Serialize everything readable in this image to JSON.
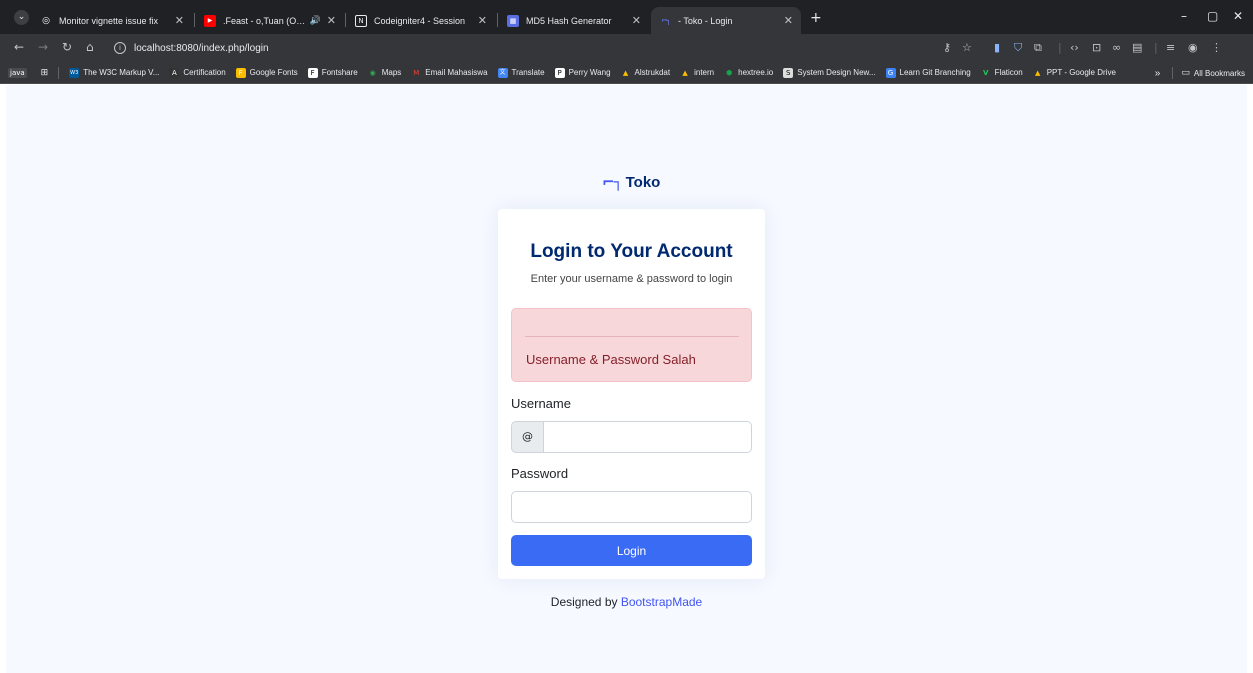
{
  "browser": {
    "tabs": [
      {
        "title": "Monitor vignette issue fix",
        "favicon": "chatgpt-icon",
        "favicon_glyph": "◎",
        "favicon_color": "#ffffff"
      },
      {
        "title": ".Feast - o,Tuan (Official Lyric",
        "favicon": "youtube-icon",
        "favicon_glyph": "▶",
        "favicon_color": "#ff0000"
      },
      {
        "title": "Codeigniter4 - Session",
        "favicon": "notion-icon",
        "favicon_glyph": "N",
        "favicon_color": "#ffffff"
      },
      {
        "title": "MD5 Hash Generator",
        "favicon": "md5-icon",
        "favicon_glyph": "▦",
        "favicon_color": "#5b6ee1"
      },
      {
        "title": " - Toko - Login",
        "favicon": "toko-icon",
        "favicon_glyph": "⌐┐",
        "favicon_color": "#6c7bff"
      }
    ],
    "new_tab": "+",
    "window_controls": {
      "minimize": "–",
      "restore": "▢",
      "close": "✕"
    },
    "url": "localhost:8080/index.php/login",
    "bookmarks": [
      {
        "label": "java",
        "icon": "java-icon",
        "color": "#35363a"
      },
      {
        "label": "The W3C Markup V...",
        "icon": "w3c-icon",
        "color": "#005a9c",
        "glyph": "W3"
      },
      {
        "label": "Certification",
        "icon": "certification-icon",
        "color": "#333333",
        "glyph": "A"
      },
      {
        "label": "Google Fonts",
        "icon": "google-fonts-icon",
        "color": "#fbbc04",
        "glyph": "F"
      },
      {
        "label": "Fontshare",
        "icon": "fontshare-icon",
        "color": "#ffffff",
        "glyph": "F"
      },
      {
        "label": "Maps",
        "icon": "maps-icon",
        "color": "#34a853",
        "glyph": "◉"
      },
      {
        "label": "Email Mahasiswa",
        "icon": "gmail-icon",
        "color": "#ea4335",
        "glyph": "M"
      },
      {
        "label": "Translate",
        "icon": "translate-icon",
        "color": "#4285f4",
        "glyph": "文"
      },
      {
        "label": "Perry Wang",
        "icon": "perry-wang-icon",
        "color": "#444444",
        "glyph": "P"
      },
      {
        "label": "Alstrukdat",
        "icon": "drive-icon",
        "color": "#fbbc04",
        "glyph": "▲"
      },
      {
        "label": "intern",
        "icon": "drive-icon",
        "color": "#fbbc04",
        "glyph": "▲"
      },
      {
        "label": "hextree.io",
        "icon": "hextree-icon",
        "color": "#16a34a",
        "glyph": "⬢"
      },
      {
        "label": "System Design New...",
        "icon": "system-design-icon",
        "color": "#555555",
        "glyph": "S"
      },
      {
        "label": "Learn Git Branching",
        "icon": "git-icon",
        "color": "#3b82f6",
        "glyph": "G"
      },
      {
        "label": "Flaticon",
        "icon": "flaticon-icon",
        "color": "#22c55e",
        "glyph": "V"
      },
      {
        "label": "PPT - Google Drive",
        "icon": "drive-icon",
        "color": "#fbbc04",
        "glyph": "▲"
      }
    ],
    "bookmarks_more": "»",
    "all_bookmarks": "All Bookmarks"
  },
  "page": {
    "brand": "Toko",
    "logo_glyph": "⌐┐",
    "title": "Login to Your Account",
    "subtitle": "Enter your username & password to login",
    "alert_message": "Username & Password Salah",
    "username_label": "Username",
    "username_prefix": "@",
    "username_value": "",
    "password_label": "Password",
    "password_value": "",
    "login_button": "Login",
    "credits_prefix": "Designed by ",
    "credits_link": "BootstrapMade"
  },
  "colors": {
    "primary": "#4154f1",
    "heading": "#012970",
    "button": "#3a6bf5",
    "alert_bg": "#f8d7da",
    "alert_text": "#842029",
    "page_bg": "#f6f9ff"
  }
}
